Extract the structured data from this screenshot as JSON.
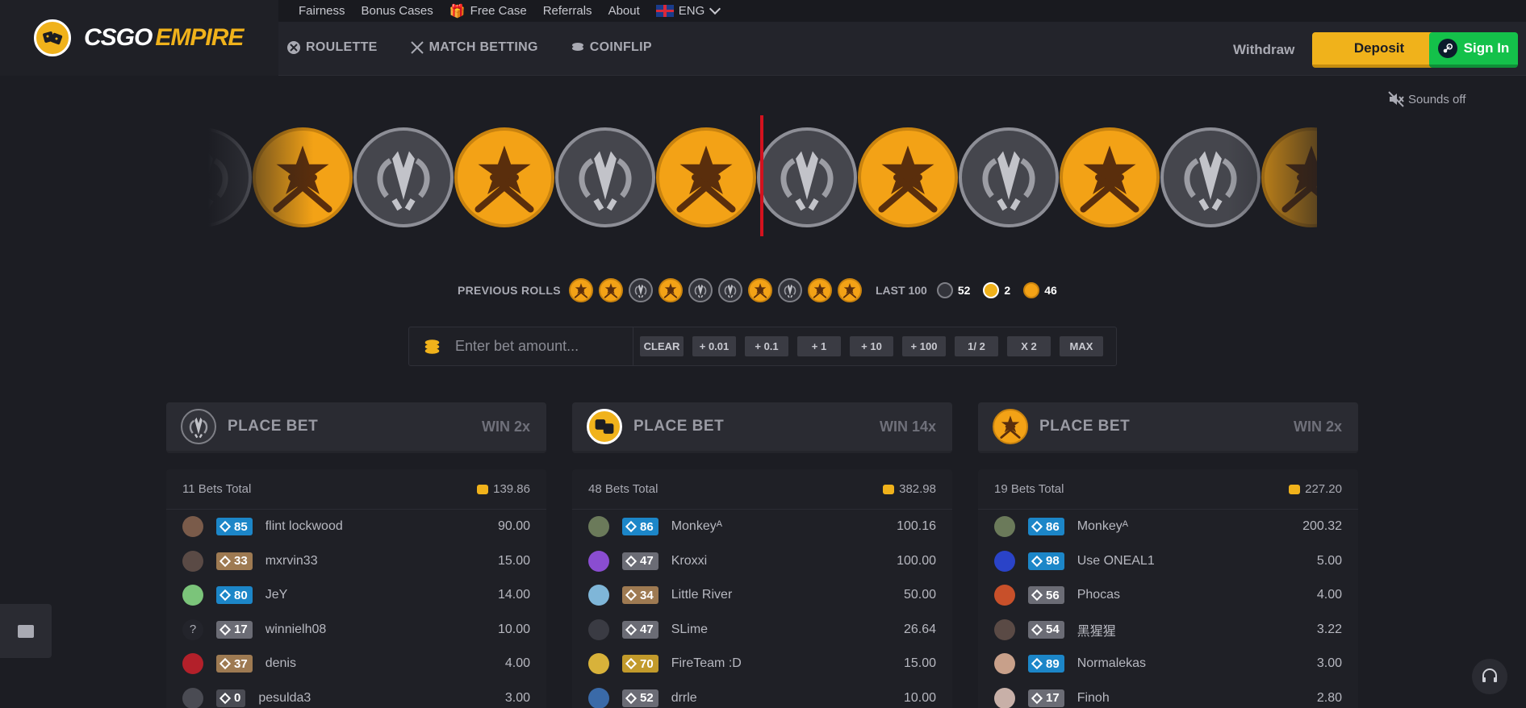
{
  "brand": {
    "name_white": "CSGO",
    "name_yellow": "EMPIRE"
  },
  "topnav": {
    "fairness": "Fairness",
    "bonus_cases": "Bonus Cases",
    "free_case": "Free Case",
    "referrals": "Referrals",
    "about": "About",
    "language": "ENG"
  },
  "mainnav": {
    "roulette": "ROULETTE",
    "match_betting": "MATCH BETTING",
    "coinflip": "COINFLIP"
  },
  "actions": {
    "withdraw": "Withdraw",
    "deposit": "Deposit",
    "signin": "Sign In"
  },
  "sounds": {
    "label": "Sounds off"
  },
  "colors": {
    "t_coin": "#f3a216",
    "ct_coin": "#45464d",
    "accent": "#f0b21b",
    "steam_green": "#14c14a",
    "marker_red": "#d3121e"
  },
  "strip": [
    "ct",
    "t",
    "ct",
    "t",
    "ct",
    "t",
    "ct",
    "t",
    "ct",
    "t",
    "ct",
    "t"
  ],
  "previous_rolls": {
    "label": "PREVIOUS ROLLS",
    "rolls": [
      "t",
      "t",
      "ct",
      "t",
      "ct",
      "ct",
      "t",
      "ct",
      "t",
      "t"
    ]
  },
  "last100": {
    "label": "LAST 100",
    "ct": "52",
    "bonus": "2",
    "t": "46"
  },
  "bet": {
    "placeholder": "Enter bet amount...",
    "chips": [
      "CLEAR",
      "+ 0.01",
      "+ 0.1",
      "+ 1",
      "+ 10",
      "+ 100",
      "1/ 2",
      "X 2",
      "MAX"
    ]
  },
  "columns": [
    {
      "side": "ct",
      "place_label": "PLACE BET",
      "win": "WIN 2x",
      "bets_total": "11 Bets Total",
      "amount_total": "139.86",
      "rows": [
        {
          "avatar_color": "#7a5b4a",
          "level": "85",
          "level_color": "blue",
          "name": "flint lockwood",
          "amount": "90.00"
        },
        {
          "avatar_color": "#5a4a45",
          "level": "33",
          "level_color": "bronze",
          "name": "mxrvin33",
          "amount": "15.00"
        },
        {
          "avatar_color": "#7bc47a",
          "level": "80",
          "level_color": "blue",
          "name": "JeY",
          "amount": "14.00"
        },
        {
          "avatar_color": "#23242b",
          "avatar_text": "?",
          "level": "17",
          "level_color": "gray",
          "name": "winnielh08",
          "amount": "10.00"
        },
        {
          "avatar_color": "#b3202a",
          "level": "37",
          "level_color": "bronze",
          "name": "denis",
          "amount": "4.00"
        },
        {
          "avatar_color": "#4a4b53",
          "level": "0",
          "level_color": "dark",
          "name": "pesulda3",
          "amount": "3.00"
        }
      ]
    },
    {
      "side": "bonus",
      "place_label": "PLACE BET",
      "win": "WIN 14x",
      "bets_total": "48 Bets Total",
      "amount_total": "382.98",
      "rows": [
        {
          "avatar_color": "#6b7a5a",
          "level": "86",
          "level_color": "blue",
          "name": "Monkeyᴬ",
          "amount": "100.16"
        },
        {
          "avatar_color": "#8a4dd1",
          "level": "47",
          "level_color": "gray",
          "name": "Kroxxi",
          "amount": "100.00"
        },
        {
          "avatar_color": "#7fb6d8",
          "level": "34",
          "level_color": "bronze",
          "name": "Little River",
          "amount": "50.00"
        },
        {
          "avatar_color": "#3a3b43",
          "level": "47",
          "level_color": "gray",
          "name": "SLime",
          "amount": "26.64"
        },
        {
          "avatar_color": "#d8b23a",
          "level": "70",
          "level_color": "gold",
          "name": "FireTeam :D",
          "amount": "15.00"
        },
        {
          "avatar_color": "#3a6aa8",
          "level": "52",
          "level_color": "gray",
          "name": "drrle",
          "amount": "10.00"
        }
      ]
    },
    {
      "side": "t",
      "place_label": "PLACE BET",
      "win": "WIN 2x",
      "bets_total": "19 Bets Total",
      "amount_total": "227.20",
      "rows": [
        {
          "avatar_color": "#6b7a5a",
          "level": "86",
          "level_color": "blue",
          "name": "Monkeyᴬ",
          "amount": "200.32"
        },
        {
          "avatar_color": "#2a43c8",
          "level": "98",
          "level_color": "blue",
          "name": "Use ONEAL1",
          "amount": "5.00"
        },
        {
          "avatar_color": "#c8502a",
          "level": "56",
          "level_color": "gray",
          "name": "Phocas",
          "amount": "4.00"
        },
        {
          "avatar_color": "#5a4a45",
          "level": "54",
          "level_color": "gray",
          "name": "黑猩猩",
          "amount": "3.22"
        },
        {
          "avatar_color": "#c8a08a",
          "level": "89",
          "level_color": "blue",
          "name": "Normalekas",
          "amount": "3.00"
        },
        {
          "avatar_color": "#c8b0a8",
          "level": "17",
          "level_color": "gray",
          "name": "Finoh",
          "amount": "2.80"
        }
      ]
    }
  ]
}
